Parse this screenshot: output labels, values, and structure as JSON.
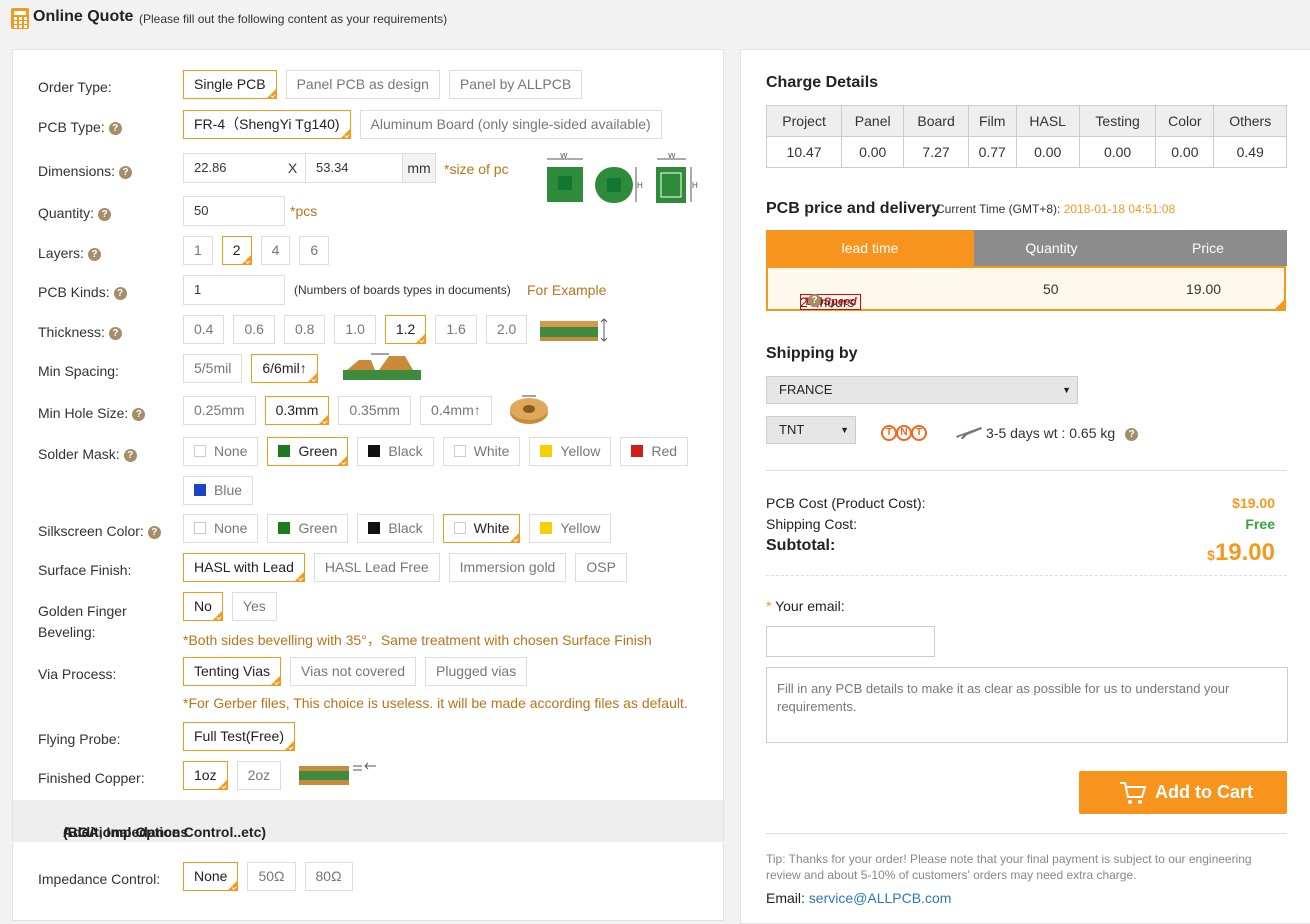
{
  "header": {
    "title": "Online Quote",
    "subtitle": "(Please fill out the following content as your requirements)"
  },
  "form": {
    "order_type": {
      "label": "Order Type:",
      "options": [
        "Single PCB",
        "Panel PCB as design",
        "Panel by ALLPCB"
      ],
      "selected": 0
    },
    "pcb_type": {
      "label": "PCB Type:",
      "options": [
        "FR-4（ShengYi Tg140)",
        "Aluminum Board (only single-sided available)"
      ],
      "selected": 0
    },
    "dimensions": {
      "label": "Dimensions:",
      "width": "22.86",
      "x": "X",
      "height": "53.34",
      "unit": "mm",
      "note": "*size of pc"
    },
    "quantity": {
      "label": "Quantity:",
      "value": "50",
      "unit": "*pcs"
    },
    "layers": {
      "label": "Layers:",
      "options": [
        "1",
        "2",
        "4",
        "6"
      ],
      "selected": 1
    },
    "pcb_kinds": {
      "label": "PCB Kinds:",
      "value": "1",
      "hint": "(Numbers of boards types in documents)",
      "example": "For Example"
    },
    "thickness": {
      "label": "Thickness:",
      "options": [
        "0.4",
        "0.6",
        "0.8",
        "1.0",
        "1.2",
        "1.6",
        "2.0"
      ],
      "selected": 4
    },
    "min_spacing": {
      "label": "Min Spacing:",
      "options": [
        "5/5mil",
        "6/6mil↑"
      ],
      "selected": 1
    },
    "min_hole": {
      "label": "Min Hole Size:",
      "options": [
        "0.25mm",
        "0.3mm",
        "0.35mm",
        "0.4mm↑"
      ],
      "selected": 1
    },
    "solder_mask": {
      "label": "Solder Mask:",
      "options": [
        {
          "name": "None",
          "color": "#ffffff"
        },
        {
          "name": "Green",
          "color": "#1e7a1e"
        },
        {
          "name": "Black",
          "color": "#111111"
        },
        {
          "name": "White",
          "color": "#ffffff"
        },
        {
          "name": "Yellow",
          "color": "#f5d000"
        },
        {
          "name": "Red",
          "color": "#d01c1c"
        },
        {
          "name": "Blue",
          "color": "#1c44c8"
        }
      ],
      "selected": 1
    },
    "silkscreen": {
      "label": "Silkscreen Color:",
      "options": [
        {
          "name": "None",
          "color": "#ffffff"
        },
        {
          "name": "Green",
          "color": "#1e7a1e"
        },
        {
          "name": "Black",
          "color": "#111111"
        },
        {
          "name": "White",
          "color": "#ffffff"
        },
        {
          "name": "Yellow",
          "color": "#f5d000"
        }
      ],
      "selected": 3
    },
    "surface_finish": {
      "label": "Surface Finish:",
      "options": [
        "HASL with Lead",
        "HASL Lead Free",
        "Immersion gold",
        "OSP"
      ],
      "selected": 0
    },
    "golden_finger": {
      "label_1": "Golden Finger",
      "label_2": "Beveling:",
      "options": [
        "No",
        "Yes"
      ],
      "selected": 0,
      "note": "*Both sides bevelling with 35°，Same treatment with chosen Surface Finish"
    },
    "via_process": {
      "label": "Via Process:",
      "options": [
        "Tenting Vias",
        "Vias not covered",
        "Plugged vias"
      ],
      "selected": 0,
      "note": "*For Gerber files, This choice is useless. it will be made according files as default."
    },
    "flying_probe": {
      "label": "Flying Probe:",
      "options": [
        "Full Test(Free)"
      ],
      "selected": 0
    },
    "finished_copper": {
      "label": "Finished Copper:",
      "options": [
        "1oz",
        "2oz"
      ],
      "selected": 0
    },
    "additional": {
      "title": "Additional Options",
      "subtitle": "(BGA, Impedance Control..etc)"
    },
    "impedance": {
      "label": "Impedance Control:",
      "options": [
        "None",
        "50Ω",
        "80Ω"
      ],
      "selected": 0
    }
  },
  "charge": {
    "title": "Charge Details",
    "headers": [
      "Project",
      "Panel",
      "Board",
      "Film",
      "HASL",
      "Testing",
      "Color",
      "Others"
    ],
    "values": [
      "10.47",
      "0.00",
      "7.27",
      "0.77",
      "0.00",
      "0.00",
      "0.00",
      "0.49"
    ]
  },
  "delivery": {
    "title": "PCB price and delivery",
    "time_label": "Current Time (GMT+8):",
    "time_value": "2018-01-18 04:51:08",
    "headers": [
      "lead time",
      "Quantity",
      "Price"
    ],
    "badge": "TopSpeed",
    "lead": "24 hours",
    "qty": "50",
    "price": "19.00"
  },
  "shipping": {
    "title": "Shipping by",
    "country": "FRANCE",
    "carrier": "TNT",
    "logo": "TNT",
    "info": "3-5 days wt : 0.65 kg"
  },
  "cost": {
    "pcb_label": "PCB Cost (Product Cost):",
    "pcb_value": "$19.00",
    "ship_label": "Shipping Cost:",
    "ship_value": "Free",
    "subtotal_label": "Subtotal:",
    "subtotal_currency": "$",
    "subtotal_value": "19.00"
  },
  "contact": {
    "email_label": "Your email:",
    "email_value": "",
    "details_placeholder": "Fill in any PCB details to make it as clear as possible for us to understand your requirements.",
    "add_to_cart": "Add to Cart",
    "tip": "Tip: Thanks for your order! Please note that your final payment is subject to our engineering review and about 5-10% of customers' orders may need extra charge.",
    "email_footer_label": "Email:",
    "email_footer_link": "service@ALLPCB.com"
  },
  "colors": {
    "accent": "#f39a1e",
    "note": "#b8741a",
    "header_gray": "#8c8c8c"
  }
}
